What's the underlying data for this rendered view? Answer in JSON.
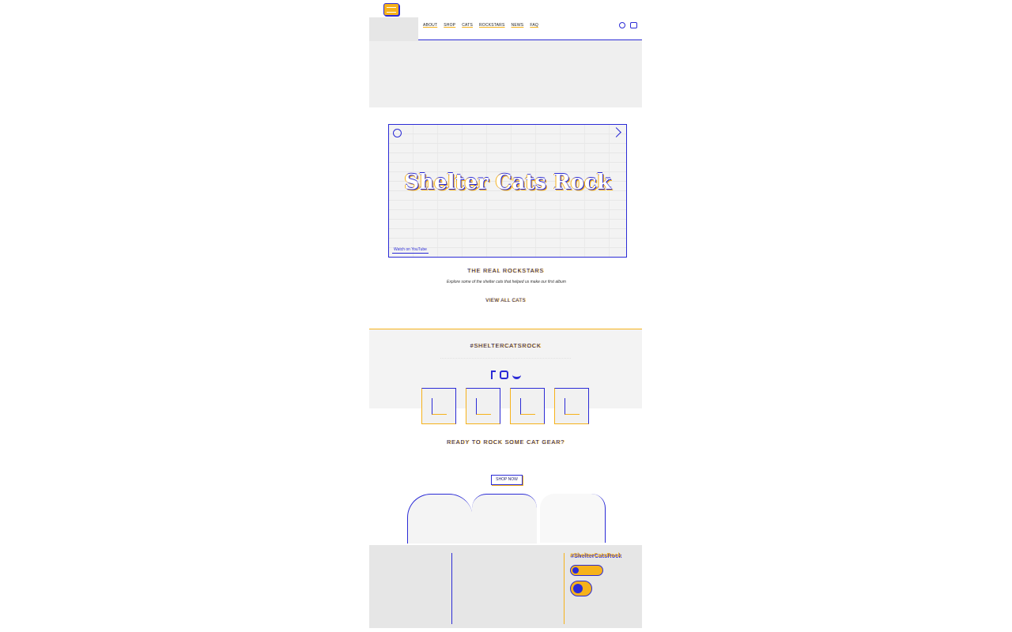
{
  "nav": {
    "items": [
      "ABOUT",
      "SHOP",
      "CATS",
      "ROCKSTARS",
      "NEWS",
      "FAQ"
    ]
  },
  "video": {
    "title": "Shelter Cats Rock",
    "watch_label": "Watch on YouTube"
  },
  "rockstars": {
    "title": "THE REAL ROCKSTARS",
    "description": "Explore some of the shelter cats that helped us make our first album",
    "link": "VIEW ALL CATS"
  },
  "social": {
    "hashtag": "#SHELTERCATSROCK"
  },
  "shop": {
    "title": "READY TO ROCK SOME CAT GEAR?",
    "button": "SHOP NOW"
  },
  "footer": {
    "brand": "#ShelterCatsRock"
  },
  "colors": {
    "accent_blue": "#2b2bd6",
    "accent_gold": "#f6b21a"
  }
}
